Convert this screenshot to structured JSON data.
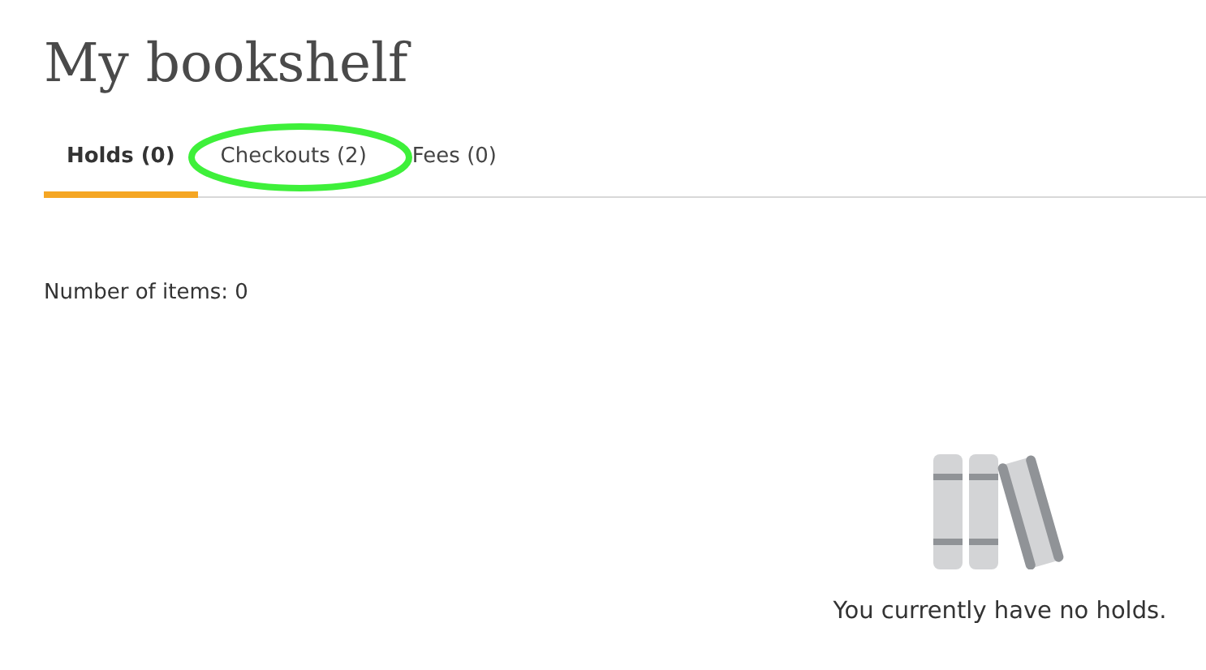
{
  "title": "My bookshelf",
  "tabs": [
    {
      "label": "Holds (0)",
      "selected": true,
      "highlighted": false
    },
    {
      "label": "Checkouts (2)",
      "selected": false,
      "highlighted": true
    },
    {
      "label": "Fees (0)",
      "selected": false,
      "highlighted": false
    }
  ],
  "item_count": "Number of items: 0",
  "empty_state": {
    "message": "You currently have no holds."
  }
}
